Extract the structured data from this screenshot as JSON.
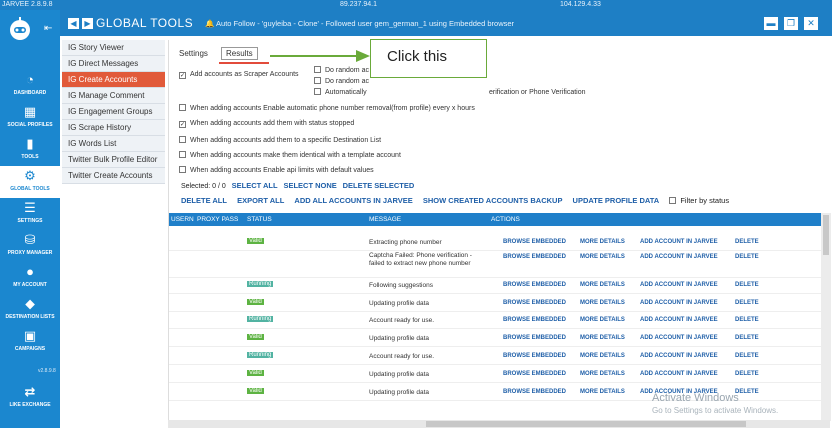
{
  "window": {
    "title": "JARVEE 2.8.9.8",
    "ip_left": "89.237.94.1",
    "ip_right": "104.129.4.33"
  },
  "leftnav": {
    "items": [
      {
        "label": "DASHBOARD",
        "icon": "dashboard-icon"
      },
      {
        "label": "SOCIAL PROFILES",
        "icon": "profiles-icon"
      },
      {
        "label": "TOOLS",
        "icon": "tools-icon"
      },
      {
        "label": "GLOBAL TOOLS",
        "icon": "global-tools-icon",
        "active": true
      },
      {
        "label": "SETTINGS",
        "icon": "settings-icon"
      },
      {
        "label": "PROXY MANAGER",
        "icon": "proxy-icon"
      },
      {
        "label": "MY ACCOUNT",
        "icon": "account-icon"
      },
      {
        "label": "DESTINATION LISTS",
        "icon": "destination-icon"
      },
      {
        "label": "CAMPAIGNS",
        "icon": "campaigns-icon"
      },
      {
        "label": "LIKE EXCHANGE",
        "icon": "exchange-icon"
      }
    ],
    "version": "v2.8.9.8"
  },
  "header": {
    "title": "GLOBAL TOOLS",
    "status": "Auto Follow - 'guyleiba - Clone' - Followed user gem_german_1 using Embedded browser"
  },
  "tools": [
    "IG Story Viewer",
    "IG Direct Messages",
    "IG Create Accounts",
    "IG Manage Comment",
    "IG Engagement Groups",
    "IG Scrape History",
    "IG Words List",
    "Twitter Bulk Profile Editor",
    "Twitter Create Accounts"
  ],
  "tabs": {
    "settings": "Settings",
    "results": "Results"
  },
  "callout": "Click this",
  "options": {
    "scraper": "Add accounts as Scraper Accounts",
    "rand1": "Do random ac",
    "rand2": "Do random ac",
    "auto": "Automatically",
    "verif": "erification or Phone Verification",
    "phone": "When adding accounts Enable automatic phone number removal(from profile) every x hours",
    "stopped": "When adding accounts add them with status stopped",
    "dest": "When adding accounts add them to a specific Destination List",
    "identical": "When adding accounts make them identical with a template account",
    "api": "When adding accounts Enable api limits with default values"
  },
  "selection": {
    "label": "Selected:",
    "count": "0 / 0",
    "select_all": "SELECT ALL",
    "select_none": "SELECT NONE",
    "delete_selected": "DELETE SELECTED"
  },
  "bulk": {
    "delete_all": "DELETE ALL",
    "export_all": "EXPORT ALL",
    "add_all": "ADD ALL ACCOUNTS IN JARVEE",
    "show_backup": "SHOW CREATED ACCOUNTS BACKUP",
    "update_profile": "UPDATE PROFILE DATA",
    "filter": "Filter by status"
  },
  "table": {
    "headers": {
      "user": "USERN",
      "proxy": "PROXY PASS",
      "status": "STATUS",
      "message": "MESSAGE",
      "actions": "ACTIONS"
    },
    "actions": {
      "browse": "BROWSE EMBEDDED",
      "more": "MORE DETAILS",
      "add": "ADD ACCOUNT IN JARVEE",
      "delete": "DELETE"
    },
    "rows": [
      {
        "status": "Valid",
        "message": "Extracting phone number"
      },
      {
        "status": "",
        "message": "Captcha Failed: Phone verification - failed to extract new phone number"
      },
      {
        "status": "Running",
        "message": "Following suggestions"
      },
      {
        "status": "Valid",
        "message": "Updating profile data"
      },
      {
        "status": "Running",
        "message": "Account ready for use."
      },
      {
        "status": "Valid",
        "message": "Updating profile data"
      },
      {
        "status": "Running",
        "message": "Account ready for use."
      },
      {
        "status": "Valid",
        "message": "Updating profile data"
      },
      {
        "status": "Valid",
        "message": "Updating profile data"
      }
    ]
  },
  "watermark": {
    "line1": "Activate Windows",
    "line2": "Go to Settings to activate Windows."
  }
}
